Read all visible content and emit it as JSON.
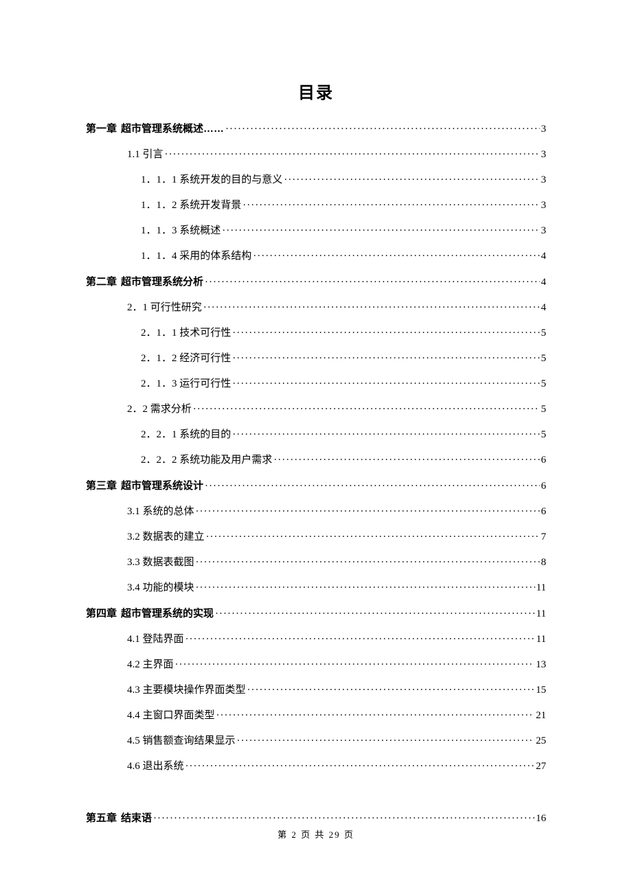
{
  "title": "目录",
  "toc": [
    {
      "level": 0,
      "chapterPrefix": "第一章",
      "text": "超市管理系统概述……",
      "page": "3"
    },
    {
      "level": 1,
      "text": "1.1 引言",
      "page": "3"
    },
    {
      "level": 2,
      "text": "1．1．1 系统开发的目的与意义",
      "page": "3"
    },
    {
      "level": 2,
      "text": "1．1．2 系统开发背景",
      "page": "3"
    },
    {
      "level": 2,
      "text": "1．1．3 系统概述",
      "page": "3"
    },
    {
      "level": 2,
      "text": "1．1．4 采用的体系结构",
      "page": "4"
    },
    {
      "level": 0,
      "chapterPrefix": "第二章",
      "text": "超市管理系统分析",
      "page": "4"
    },
    {
      "level": 1,
      "text": "2．1 可行性研究",
      "page": "4"
    },
    {
      "level": 2,
      "text": "2．1．1 技术可行性",
      "page": "5"
    },
    {
      "level": 2,
      "text": "2．1．2 经济可行性",
      "page": "5"
    },
    {
      "level": 2,
      "text": "2．1．3 运行可行性",
      "page": "5"
    },
    {
      "level": 1,
      "text": "2．2 需求分析",
      "page": "5"
    },
    {
      "level": 2,
      "text": "2．2．1 系统的目的",
      "page": "5"
    },
    {
      "level": 2,
      "text": "2．2．2 系统功能及用户需求",
      "page": "6"
    },
    {
      "level": 0,
      "chapterPrefix": "第三章",
      "text": "超市管理系统设计",
      "page": "6"
    },
    {
      "level": 1,
      "text": "3.1 系统的总体",
      "page": "6"
    },
    {
      "level": 1,
      "text": "3.2 数据表的建立",
      "page": "7"
    },
    {
      "level": 1,
      "text": "3.3 数据表截图",
      "page": "8"
    },
    {
      "level": 1,
      "text": "3.4 功能的模块",
      "page": "11"
    },
    {
      "level": 0,
      "chapterPrefix": "第四章",
      "text": "超市管理系统的实现",
      "page": "11"
    },
    {
      "level": 1,
      "text": "4.1 登陆界面",
      "page": "11"
    },
    {
      "level": 1,
      "text": "4.2 主界面",
      "page": "13"
    },
    {
      "level": 1,
      "text": "4.3 主要模块操作界面类型",
      "page": "15"
    },
    {
      "level": 1,
      "text": "4.4 主窗口界面类型",
      "page": "21"
    },
    {
      "level": 1,
      "text": "4.5 销售额查询结果显示",
      "page": "25"
    },
    {
      "level": 1,
      "text": "4.6 退出系统",
      "page": "27"
    },
    {
      "spacer": true
    },
    {
      "level": 0,
      "chapterPrefix": "第五章",
      "text": "结束语",
      "page": "16"
    }
  ],
  "footer": "第 2 页 共 29 页"
}
